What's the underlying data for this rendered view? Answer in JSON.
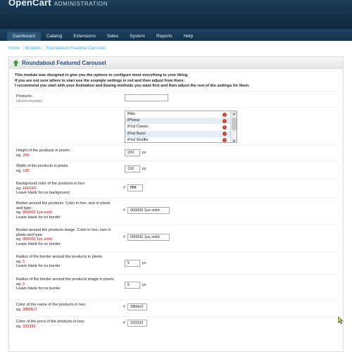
{
  "header": {
    "brand": "OpenCart",
    "subtitle": "ADMINISTRATION"
  },
  "menu": {
    "items": [
      "Dashboard",
      "Catalog",
      "Extensions",
      "Sales",
      "System",
      "Reports",
      "Help"
    ]
  },
  "breadcrumb": {
    "items": [
      "Home",
      "Modules",
      "Roundabout Featured Carousel"
    ],
    "separator": "::"
  },
  "module": {
    "title": "Roundabout Featured Carousel",
    "intro": [
      "This module was designed to give you the options to configure most everything to your liking.",
      "If you are not sure where to start use the example settings in red and then adjust from there.",
      "I recommend you start with your Animation and Easing methods you want first and then adjust the rest of the settings for them."
    ]
  },
  "form": {
    "products": {
      "label": "Products:",
      "hint": "(Autocomplete)",
      "value": "",
      "list": [
        "iMac",
        "iPhone",
        "iPod Classic",
        "iPod Nano",
        "iPod Shuffle"
      ]
    },
    "height": {
      "label": "Height of the products in pixels:",
      "example_prefix": "eg.",
      "example": "200",
      "value": "200",
      "unit": "px"
    },
    "width": {
      "label": "Width of the products in pixels:",
      "example_prefix": "eg.",
      "example": "130",
      "value": "130",
      "unit": "px"
    },
    "bg_color": {
      "label": "Background color of the products in hex:",
      "example_prefix": "eg.",
      "example": "FFFFFF",
      "note": "Leave blank for no background",
      "hash": "#",
      "value": "ffffff"
    },
    "border": {
      "label": "Border around the products. Color in hex, size in pixels and type:",
      "example_prefix": "eg.",
      "example": "000000 1px solid",
      "note": "Leave blank for no border",
      "hash": "#",
      "value": "000000 1px solid"
    },
    "image_border": {
      "label": "Border around the products image. Color in hex, size in pixels and type:",
      "example_prefix": "eg.",
      "example": "000000 1px solid",
      "note": "Leave blank for no border",
      "hash": "#",
      "value": "000000 1px solid"
    },
    "radius": {
      "label": "Radius of the border around the products in pixels:",
      "example_prefix": "eg.",
      "example": "5",
      "note": "Leave blank for no border",
      "value": "5",
      "unit": "px"
    },
    "image_radius": {
      "label": "Radius of the border around the products image in pixels:",
      "example_prefix": "eg.",
      "example": "5",
      "note": "Leave blank for no border",
      "value": "5",
      "unit": "px"
    },
    "name_color": {
      "label": "Color of the name of the products in hex:",
      "example_prefix": "eg.",
      "example": "38B0E3",
      "hash": "#",
      "value": "38b0e3"
    },
    "price_color": {
      "label": "Color of the price of the products in hex:",
      "example_prefix": "eg.",
      "example": "333333",
      "hash": "#",
      "value": "333333"
    }
  },
  "colors": {
    "header_bg": "#1c3e59",
    "example_red": "#cc0000",
    "title_blue": "#2b4f7c",
    "link_blue": "#38b0e3"
  }
}
